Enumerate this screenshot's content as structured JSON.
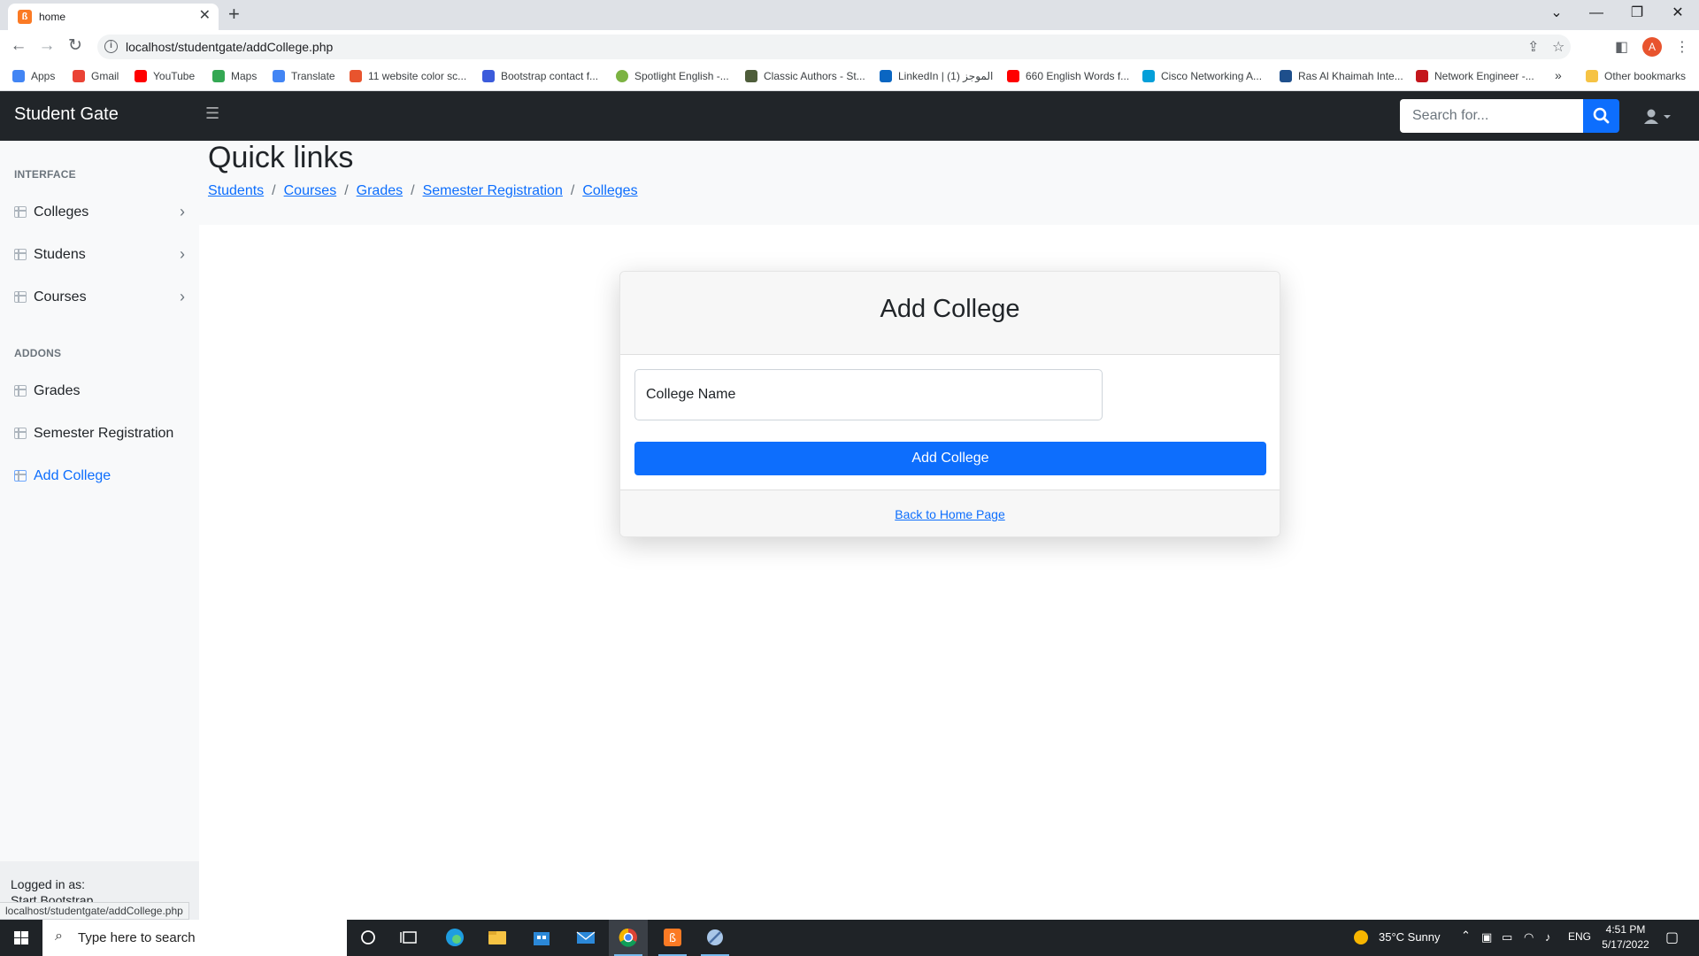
{
  "browser": {
    "tab_title": "home",
    "favicon_letter": "ß",
    "url": "localhost/studentgate/addCollege.php",
    "profile_initial": "A",
    "status_url": "localhost/studentgate/addCollege.php",
    "bookmarks": [
      {
        "label": "Apps",
        "color": "#4285f4"
      },
      {
        "label": "Gmail",
        "color": "#ea4335"
      },
      {
        "label": "YouTube",
        "color": "#ff0000"
      },
      {
        "label": "Maps",
        "color": "#34a853"
      },
      {
        "label": "Translate",
        "color": "#4285f4"
      },
      {
        "label": "11 website color sc...",
        "color": "#e8542e"
      },
      {
        "label": "Bootstrap contact f...",
        "color": "#3b5bdb"
      },
      {
        "label": "Spotlight English -...",
        "color": "#7cb342"
      },
      {
        "label": "Classic Authors - St...",
        "color": "#4e5d3a"
      },
      {
        "label": "LinkedIn | الموجز (1)",
        "color": "#0a66c2"
      },
      {
        "label": "660 English Words f...",
        "color": "#ff0000"
      },
      {
        "label": "Cisco Networking A...",
        "color": "#049fd9"
      },
      {
        "label": "Ras Al Khaimah Inte...",
        "color": "#1e4f8c"
      },
      {
        "label": "Network Engineer -...",
        "color": "#c4161c"
      }
    ],
    "other_bookmarks": "Other bookmarks"
  },
  "navbar": {
    "brand": "Student Gate",
    "search_placeholder": "Search for..."
  },
  "sidebar": {
    "heading_interface": "INTERFACE",
    "heading_addons": "ADDONS",
    "items": [
      {
        "label": "Colleges"
      },
      {
        "label": "Studens"
      },
      {
        "label": "Courses"
      },
      {
        "label": "Grades"
      },
      {
        "label": "Semester Registration"
      },
      {
        "label": "Add College"
      }
    ],
    "footer_label": "Logged in as:",
    "footer_name": "Start Bootstrap"
  },
  "quick_links": {
    "title": "Quick links",
    "links": [
      "Students",
      "Courses",
      "Grades",
      "Semester Registration",
      "Colleges"
    ]
  },
  "form": {
    "title": "Add College",
    "college_name_label": "College Name",
    "college_name_value": "",
    "submit_label": "Add College",
    "back_link": "Back to Home Page"
  },
  "taskbar": {
    "search_placeholder": "Type here to search",
    "weather": "35°C  Sunny",
    "language": "ENG",
    "time": "4:51 PM",
    "date": "5/17/2022"
  },
  "colors": {
    "primary": "#0d6efd",
    "navbar": "#212529",
    "sidebar": "#f8f9fa"
  }
}
